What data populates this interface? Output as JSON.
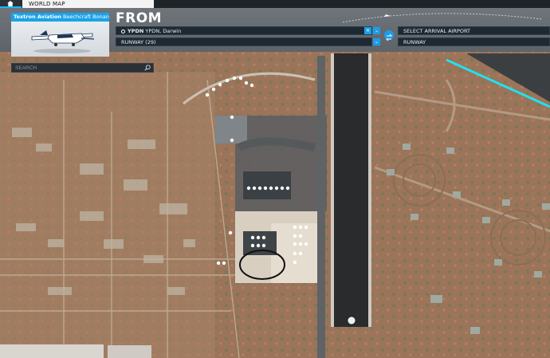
{
  "topbar": {
    "home_icon": "home-icon",
    "tab_label": "WORLD MAP"
  },
  "aircraft": {
    "maker": "Textron Aviation",
    "model": "Beechcraft Bonanza ..."
  },
  "flight": {
    "title": "FROM",
    "departure_code": "YPDN",
    "departure_name": "YPDN, Darwin",
    "departure_runway": "RUNWAY (29)",
    "arrival_placeholder": "SELECT ARRIVAL AIRPORT",
    "arrival_runway": "RUNWAY"
  },
  "search": {
    "placeholder": "SEARCH"
  },
  "colors": {
    "accent": "#1b9ee8",
    "route_line": "#22e0f0",
    "runway": "#2a2b2c"
  }
}
